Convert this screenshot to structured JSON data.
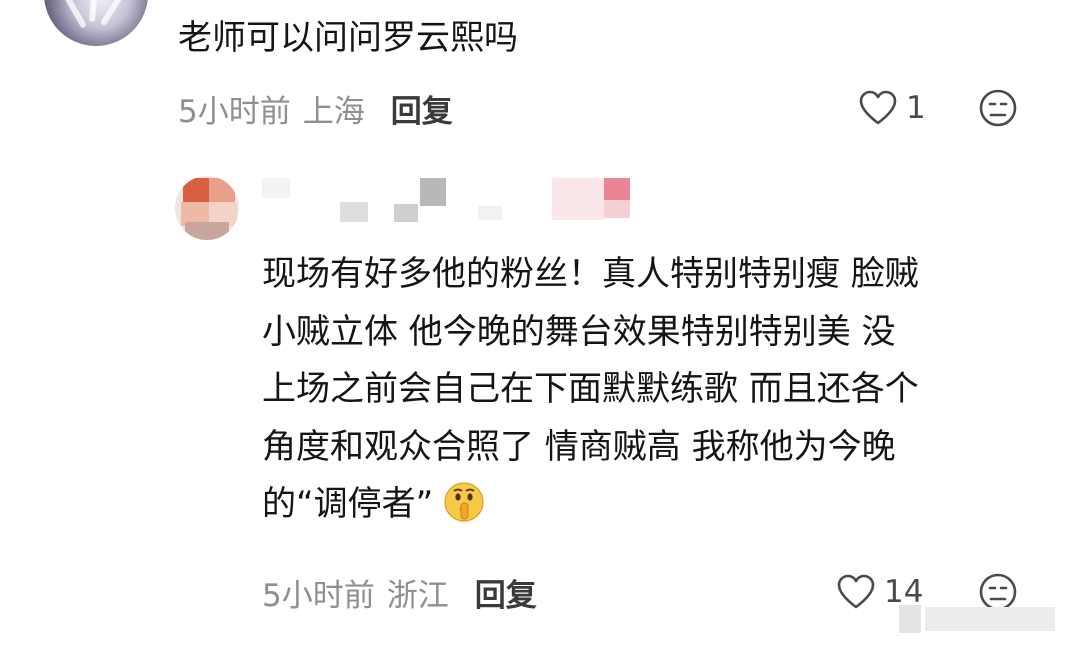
{
  "comment1": {
    "text": "老师可以问问罗云熙吗",
    "time": "5小时前",
    "location": "上海",
    "reply_label": "回复",
    "like_count": "1",
    "icons": {
      "like": "heart-icon",
      "dislike": "frown-icon"
    }
  },
  "comment2": {
    "text_lines": [
      "现场有好多他的粉丝！真人特别特别瘦 脸贼",
      "小贼立体 他今晚的舞台效果特别特别美 没",
      "上场之前会自己在下面默默练歌 而且还各个",
      "角度和观众合照了 情商贼高 我称他为今晚",
      "的“调停者”"
    ],
    "emoji": "shushing-face-emoji",
    "time": "5小时前",
    "location": "浙江",
    "reply_label": "回复",
    "like_count": "14",
    "icons": {
      "like": "heart-icon",
      "dislike": "frown-icon"
    }
  },
  "colors": {
    "text": "#151515",
    "meta": "#8f8f8f",
    "reply": "#3a3a3a",
    "icon": "#4a4a4a"
  }
}
